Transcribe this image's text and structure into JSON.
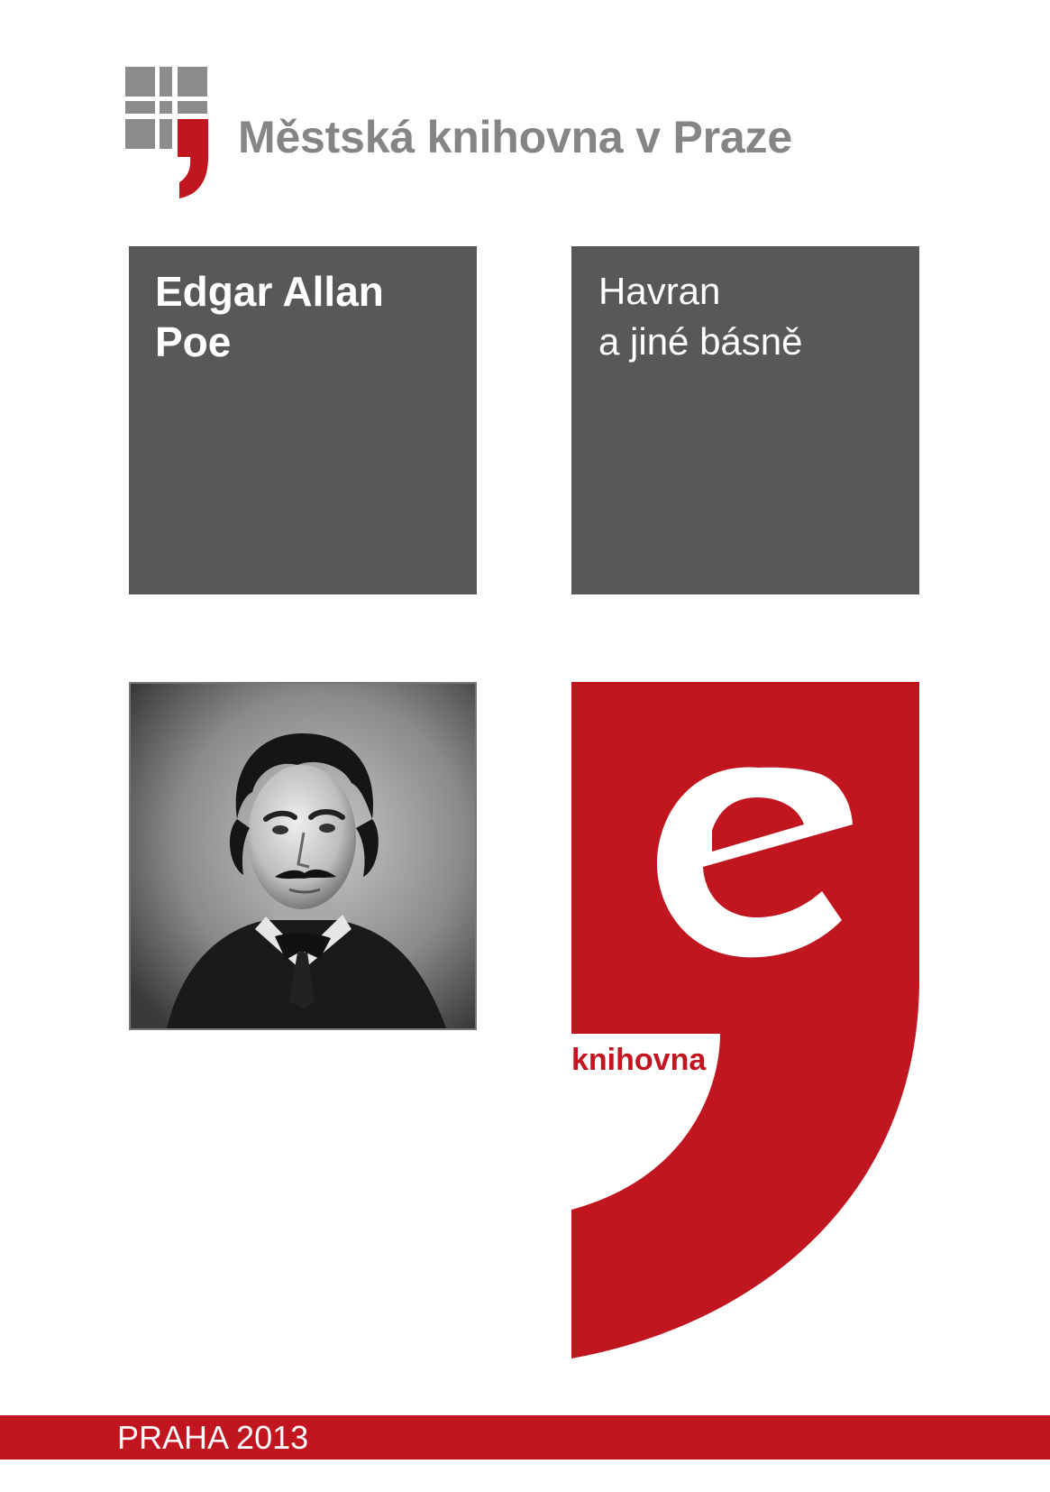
{
  "header": {
    "library_name": "Městská knihovna v Praze",
    "logo_icon": "library-logo-icon"
  },
  "author_box": {
    "line1": "Edgar Allan",
    "line2": "Poe"
  },
  "title_box": {
    "line1": "Havran",
    "line2": "a jiné básně"
  },
  "portrait": {
    "icon": "author-portrait-icon"
  },
  "brand": {
    "icon": "e-knihovna-logo-icon",
    "label": "knihovna"
  },
  "footer": {
    "text": "PRAHA 2013"
  },
  "colors": {
    "accent_red": "#c1151f",
    "box_gray": "#58585a",
    "logo_gray": "#858585"
  }
}
